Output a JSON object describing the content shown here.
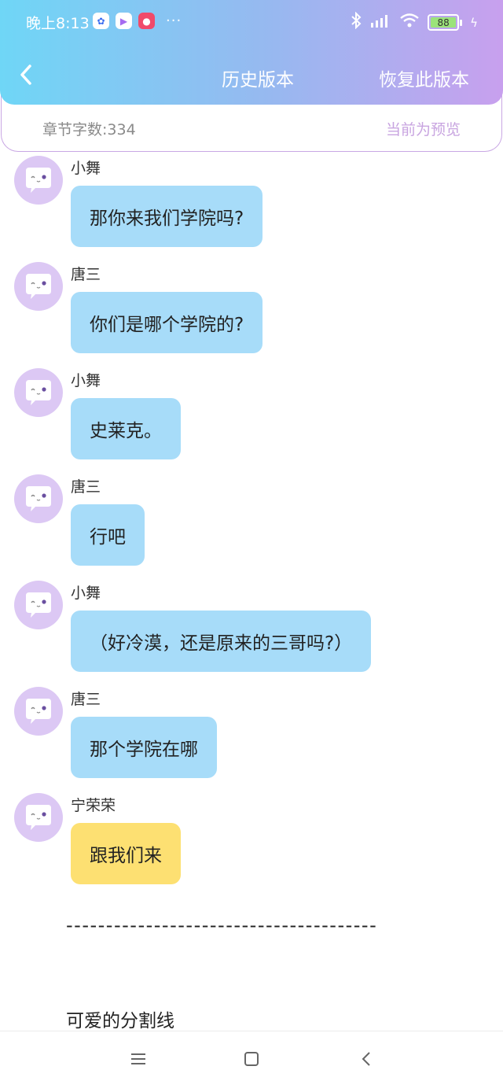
{
  "status_bar": {
    "time": "晚上8:13",
    "dots": "···",
    "battery": "88"
  },
  "header": {
    "title": "历史版本",
    "restore_label": "恢复此版本"
  },
  "info_bar": {
    "word_count": "章节字数:334",
    "preview_label": "当前为预览"
  },
  "messages": [
    {
      "sender": "小舞",
      "text": "那你来我们学院吗?"
    },
    {
      "sender": "唐三",
      "text": "你们是哪个学院的?"
    },
    {
      "sender": "小舞",
      "text": "史莱克。"
    },
    {
      "sender": "唐三",
      "text": "行吧"
    },
    {
      "sender": "小舞",
      "text": "（好冷漠，还是原来的三哥吗?）"
    },
    {
      "sender": "唐三",
      "text": "那个学院在哪"
    },
    {
      "sender": "宁荣荣",
      "text": "跟我们来"
    }
  ],
  "divider_text": "---------------------------------------",
  "cute_line": "可爱的分割线",
  "colors": {
    "header_gradient_start": "#6fd6f6",
    "header_gradient_end": "#c8a0ee",
    "bubble_blue": "#a7dcf9",
    "bubble_yellow": "#fde072",
    "preview_purple": "#c8a4e0"
  }
}
